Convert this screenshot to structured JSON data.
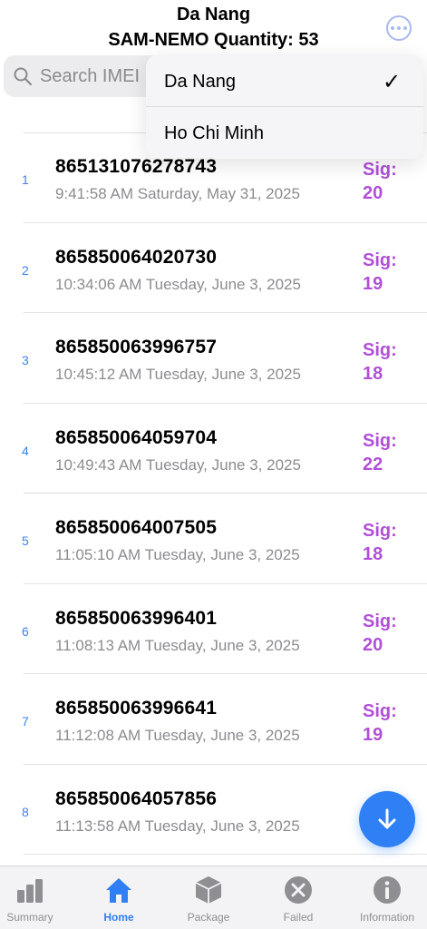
{
  "header": {
    "city": "Da Nang",
    "quantity_text": "SAM-NEMO Quantity: 53"
  },
  "search": {
    "placeholder": "Search IMEI"
  },
  "dropdown": {
    "options": [
      {
        "label": "Da Nang",
        "selected": true,
        "check": "✓"
      },
      {
        "label": "Ho Chi Minh",
        "selected": false
      }
    ]
  },
  "devices": [
    {
      "index": "1",
      "imei": "865131076278743",
      "time": "9:41:58 AM Saturday, May 31, 2025",
      "sig_label": "Sig:",
      "sig_value": "20"
    },
    {
      "index": "2",
      "imei": "865850064020730",
      "time": "10:34:06 AM Tuesday, June 3, 2025",
      "sig_label": "Sig:",
      "sig_value": "19"
    },
    {
      "index": "3",
      "imei": "865850063996757",
      "time": "10:45:12 AM Tuesday, June 3, 2025",
      "sig_label": "Sig:",
      "sig_value": "18"
    },
    {
      "index": "4",
      "imei": "865850064059704",
      "time": "10:49:43 AM Tuesday, June 3, 2025",
      "sig_label": "Sig:",
      "sig_value": "22"
    },
    {
      "index": "5",
      "imei": "865850064007505",
      "time": "11:05:10 AM Tuesday, June 3, 2025",
      "sig_label": "Sig:",
      "sig_value": "18"
    },
    {
      "index": "6",
      "imei": "865850063996401",
      "time": "11:08:13 AM Tuesday, June 3, 2025",
      "sig_label": "Sig:",
      "sig_value": "20"
    },
    {
      "index": "7",
      "imei": "865850063996641",
      "time": "11:12:08 AM Tuesday, June 3, 2025",
      "sig_label": "Sig:",
      "sig_value": "19"
    },
    {
      "index": "8",
      "imei": "865850064057856",
      "time": "11:13:58 AM Tuesday, June 3, 2025",
      "sig_label": "",
      "sig_value": ""
    }
  ],
  "tabs": [
    {
      "label": "Summary",
      "icon": "bar-chart-icon"
    },
    {
      "label": "Home",
      "icon": "house-icon",
      "active": true
    },
    {
      "label": "Package",
      "icon": "cube-icon"
    },
    {
      "label": "Failed",
      "icon": "x-circle-icon"
    },
    {
      "label": "Information",
      "icon": "info-circle-icon"
    }
  ],
  "colors": {
    "accent": "#2f7ff5",
    "signal": "#b050d8",
    "index": "#3c7ff0",
    "secondary_text": "#8c8c90"
  }
}
